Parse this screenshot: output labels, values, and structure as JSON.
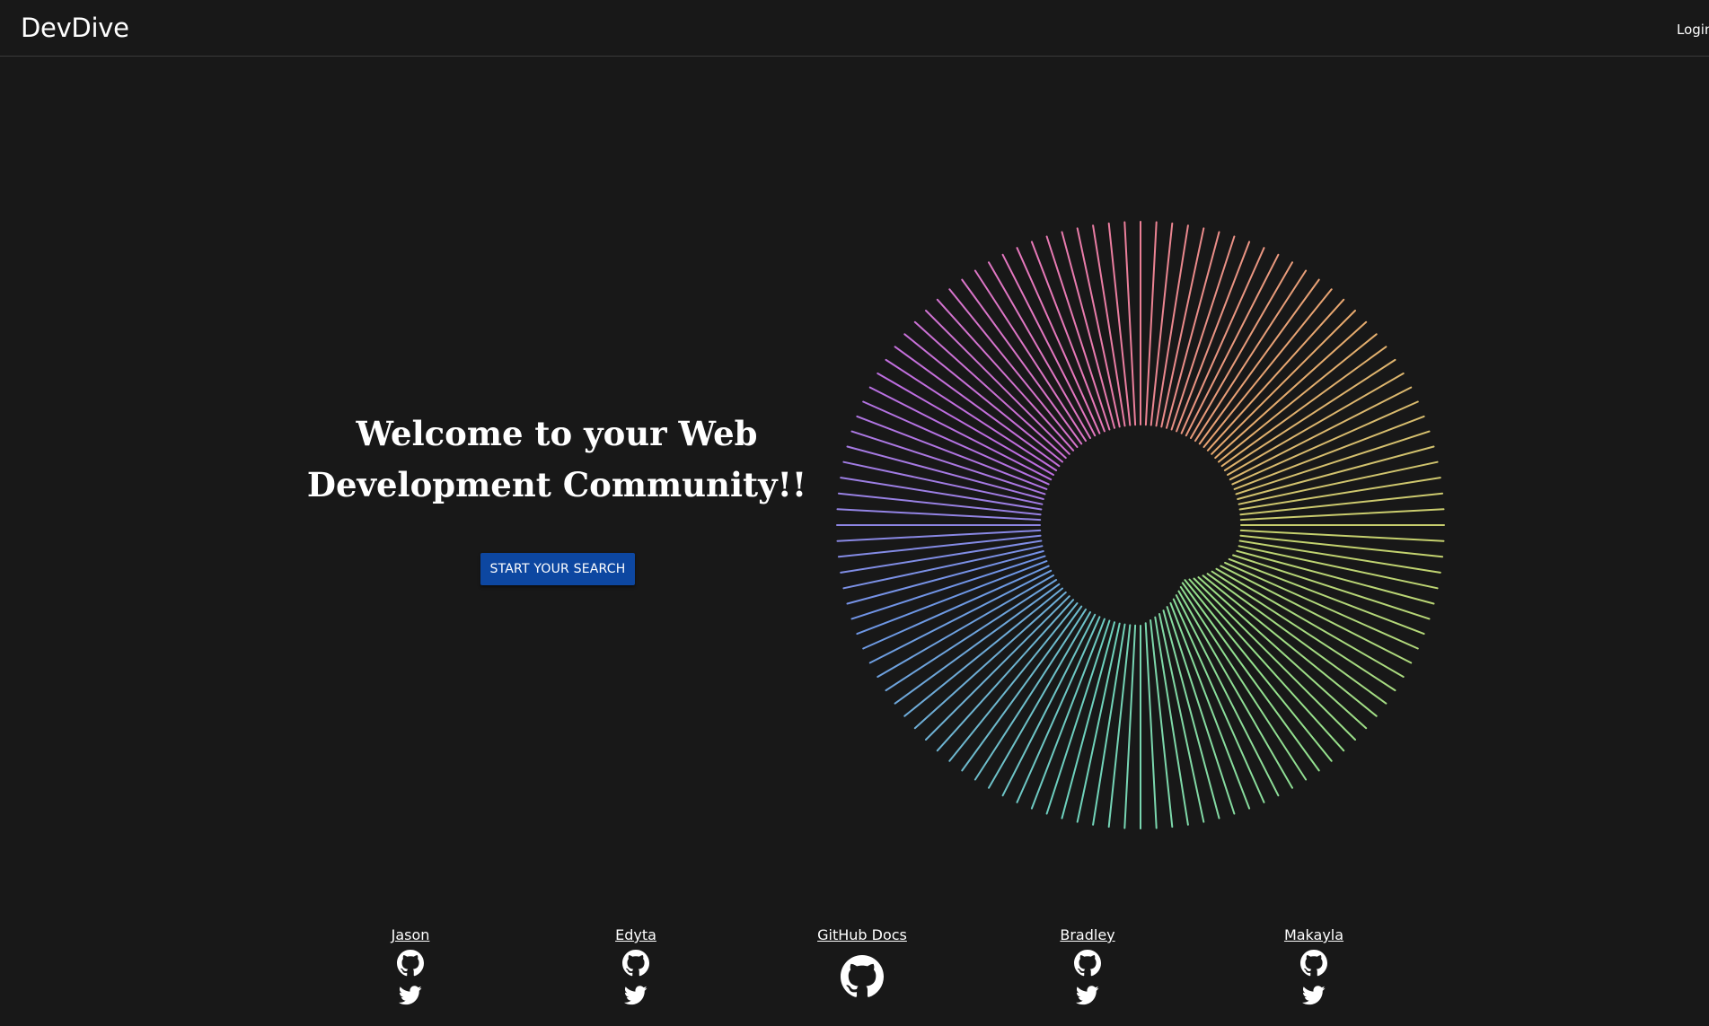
{
  "nav": {
    "brand": "DevDive",
    "login": "Login"
  },
  "hero": {
    "title_line1": "Welcome to your Web",
    "title_line2": "Development Community!!",
    "cta_label": "START YOUR SEARCH",
    "cta_color": "#0d47a1"
  },
  "footer": {
    "links": [
      {
        "name": "Jason",
        "icons": [
          "github-icon",
          "twitter-icon"
        ]
      },
      {
        "name": "Edyta",
        "icons": [
          "github-icon",
          "twitter-icon"
        ]
      },
      {
        "name": "GitHub Docs",
        "icons": [
          "github-icon"
        ]
      },
      {
        "name": "Bradley",
        "icons": [
          "github-icon",
          "twitter-icon"
        ]
      },
      {
        "name": "Makayla",
        "icons": [
          "github-icon",
          "twitter-icon"
        ]
      }
    ]
  },
  "colors": {
    "background": "#181818",
    "text": "#ffffff"
  }
}
